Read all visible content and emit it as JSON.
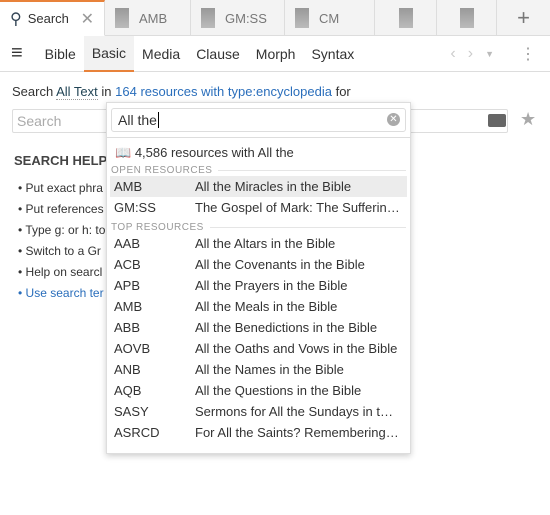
{
  "tabs": [
    {
      "label": "Search",
      "icon": "search-icon",
      "active": true
    },
    {
      "label": "AMB"
    },
    {
      "label": "GM:SS"
    },
    {
      "label": "CM"
    },
    {
      "label": ""
    },
    {
      "label": ""
    }
  ],
  "toolbar": {
    "items": [
      "Bible",
      "Basic",
      "Media",
      "Clause",
      "Morph",
      "Syntax"
    ],
    "active": "Basic"
  },
  "search_line": {
    "prefix": "Search",
    "scope": "All Text",
    "in": "in",
    "resources": "164 resources with type:encyclopedia",
    "suffix": "for"
  },
  "search_input": {
    "placeholder": "Search"
  },
  "helps": {
    "title": "SEARCH HELPS",
    "bullets": [
      "Put exact phra",
      "Put references",
      "Type g: or h: to",
      "Switch to a Gr                                                                 earch box.",
      "Help on searcl",
      "Use search ter"
    ]
  },
  "dropdown": {
    "value": "All the",
    "count": "4,586 resources with All the",
    "open_label": "OPEN RESOURCES",
    "open": [
      [
        "AMB",
        "All the Miracles in the Bible"
      ],
      [
        "GM:SS",
        "The Gospel of Mark: The Sufferin…"
      ]
    ],
    "top_label": "TOP RESOURCES",
    "top": [
      [
        "AAB",
        "All the Altars in the Bible"
      ],
      [
        "ACB",
        "All the Covenants in the Bible"
      ],
      [
        "APB",
        "All the Prayers in the Bible"
      ],
      [
        "AMB",
        "All the Meals in the Bible"
      ],
      [
        "ABB",
        "All the Benedictions in the Bible"
      ],
      [
        "AOVB",
        "All the Oaths and Vows in the Bible"
      ],
      [
        "ANB",
        "All the Names in the Bible"
      ],
      [
        "AQB",
        "All the Questions in the Bible"
      ],
      [
        "SASY",
        "Sermons for All the Sundays in t…"
      ],
      [
        "ASRCD",
        "For All the Saints? Remembering…"
      ]
    ]
  },
  "colors": {
    "accent": "#e8823a",
    "link": "#2a6ebb"
  }
}
